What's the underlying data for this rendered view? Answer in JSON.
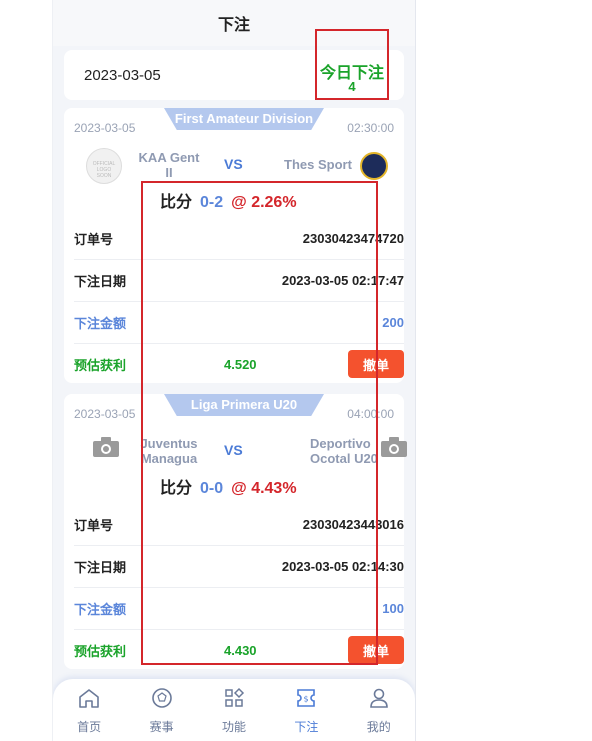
{
  "header": {
    "title": "下注"
  },
  "date_bar": {
    "date": "2023-03-05",
    "today_label": "今日下注",
    "today_count": "4"
  },
  "bets": [
    {
      "league": "First Amateur Division",
      "date": "2023-03-05",
      "time": "02:30:00",
      "home": "KAA Gent II",
      "away": "Thes Sport",
      "vs": "VS",
      "score_label": "比分",
      "score": "0-2",
      "odds": "@ 2.26%",
      "order_label": "订单号",
      "order_no": "23030423474720",
      "bet_date_label": "下注日期",
      "bet_date": "2023-03-05 02:17:47",
      "amount_label": "下注金额",
      "amount": "200",
      "profit_label": "预估获利",
      "profit": "4.520",
      "cancel_label": "撤单"
    },
    {
      "league": "Liga Primera U20",
      "date": "2023-03-05",
      "time": "04:00:00",
      "home": "Juventus Managua",
      "away": "Deportivo Ocotal U20",
      "vs": "VS",
      "score_label": "比分",
      "score": "0-0",
      "odds": "@ 4.43%",
      "order_label": "订单号",
      "order_no": "23030423443016",
      "bet_date_label": "下注日期",
      "bet_date": "2023-03-05 02:14:30",
      "amount_label": "下注金额",
      "amount": "100",
      "profit_label": "预估获利",
      "profit": "4.430",
      "cancel_label": "撤单"
    }
  ],
  "tabbar": {
    "items": [
      {
        "label": "首页",
        "icon": "home-icon"
      },
      {
        "label": "赛事",
        "icon": "ball-icon"
      },
      {
        "label": "功能",
        "icon": "grid-icon"
      },
      {
        "label": "下注",
        "icon": "ticket-icon"
      },
      {
        "label": "我的",
        "icon": "user-icon"
      }
    ],
    "active": "下注"
  },
  "colors": {
    "accent": "#4b7bd6",
    "green": "#1aa32a",
    "red": "#d4262b",
    "button": "#f4522e"
  }
}
